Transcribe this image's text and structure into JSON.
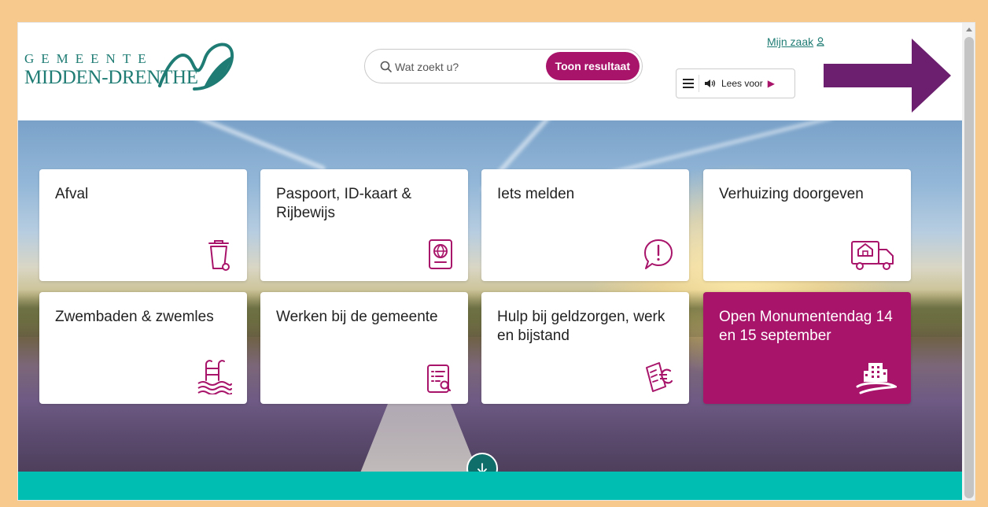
{
  "logo": {
    "line1": "GEMEENTE",
    "line2": "MIDDEN-DRENTHE"
  },
  "search": {
    "placeholder": "Wat zoekt u?",
    "button": "Toon resultaat"
  },
  "account": {
    "label": "Mijn zaak"
  },
  "readspeaker": {
    "label": "Lees voor"
  },
  "tiles": [
    {
      "title": "Afval",
      "icon": "trash-bin-icon"
    },
    {
      "title": "Paspoort, ID-kaart & Rijbewijs",
      "icon": "passport-icon"
    },
    {
      "title": "Iets melden",
      "icon": "exclamation-bubble-icon"
    },
    {
      "title": "Verhuizing doorgeven",
      "icon": "moving-truck-icon"
    },
    {
      "title": "Zwembaden & zwemles",
      "icon": "swimming-pool-ladder-icon"
    },
    {
      "title": "Werken bij de gemeente",
      "icon": "document-search-icon"
    },
    {
      "title": "Hulp bij geldzorgen, werk en bijstand",
      "icon": "euro-bills-icon"
    },
    {
      "title": "Open Monumentendag 14 en 15 september",
      "icon": "monument-building-icon"
    }
  ],
  "colors": {
    "brand_teal": "#1f7c74",
    "accent": "#a8146a",
    "footer_teal": "#00bfb2",
    "annotation_arrow": "#6b1f6e"
  }
}
